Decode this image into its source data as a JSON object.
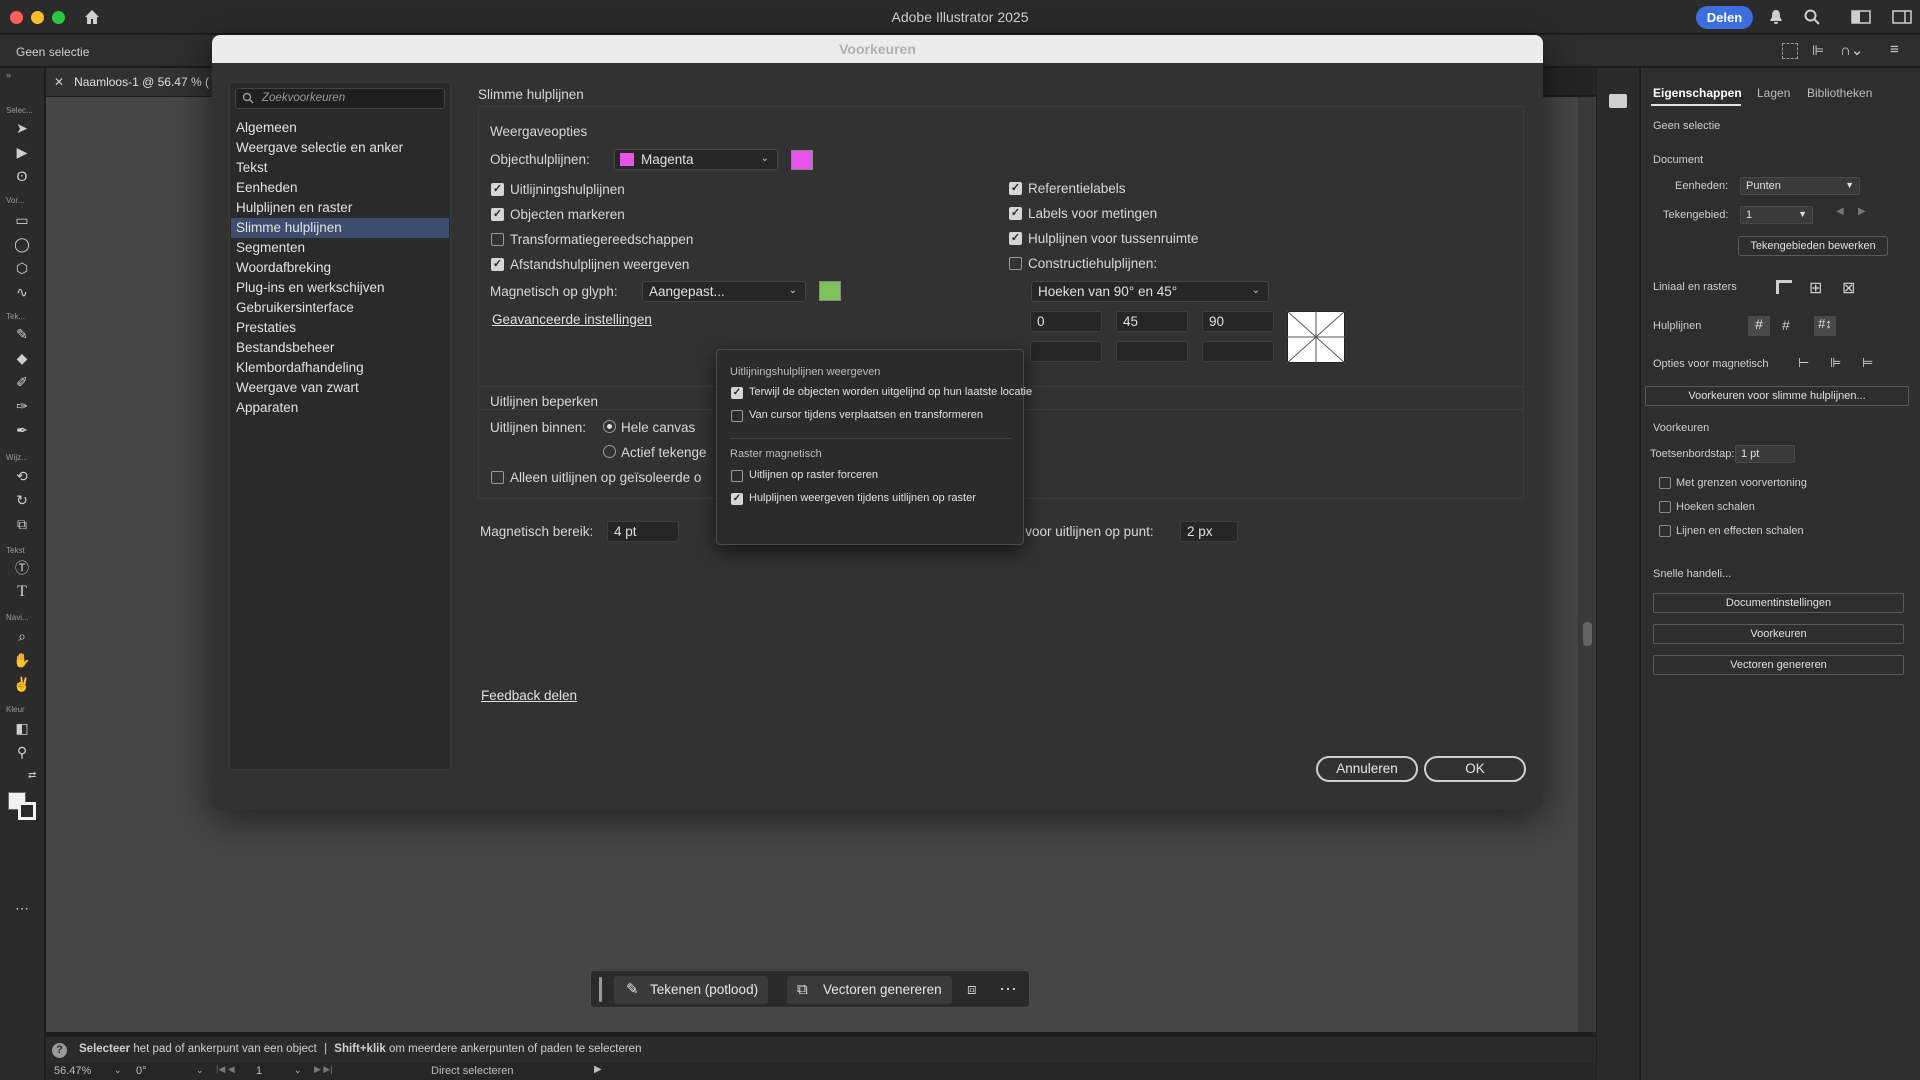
{
  "app": {
    "title": "Adobe Illustrator 2025",
    "share_label": "Delen",
    "selection_state": "Geen selectie",
    "doc_tab": "Naamloos-1 @ 56.47 % ("
  },
  "toolbar_labels": {
    "select": "Selec...",
    "draw": "Vor...",
    "text_tools": "Tek...",
    "modify": "Wijz...",
    "type": "Tekst",
    "navigate": "Navi...",
    "color": "Kleur"
  },
  "dialog": {
    "title": "Voorkeuren",
    "search_placeholder": "Zoekvoorkeuren",
    "categories": [
      "Algemeen",
      "Weergave selectie en anker",
      "Tekst",
      "Eenheden",
      "Hulplijnen en raster",
      "Slimme hulplijnen",
      "Segmenten",
      "Woordafbreking",
      "Plug-ins en werkschijven",
      "Gebruikersinterface",
      "Prestaties",
      "Bestandsbeheer",
      "Klembordafhandeling",
      "Weergave van zwart",
      "Apparaten"
    ],
    "active_category_index": 5,
    "page_title": "Slimme hulplijnen",
    "display_options": {
      "heading": "Weergaveopties",
      "object_guides_label": "Objecthulplijnen:",
      "object_guides_value": "Magenta",
      "object_guides_color": "#e754e7",
      "checks_left": [
        {
          "label": "Uitlijningshulplijnen",
          "checked": true
        },
        {
          "label": "Objecten markeren",
          "checked": true
        },
        {
          "label": "Transformatiegereedschappen",
          "checked": false
        },
        {
          "label": "Afstandshulplijnen weergeven",
          "checked": true
        }
      ],
      "checks_right": [
        {
          "label": "Referentielabels",
          "checked": true
        },
        {
          "label": "Labels voor metingen",
          "checked": true
        },
        {
          "label": "Hulplijnen voor tussenruimte",
          "checked": true
        },
        {
          "label": "Constructiehulplijnen:",
          "checked": false
        }
      ],
      "glyph_snap_label": "Magnetisch op glyph:",
      "glyph_snap_value": "Aangepast...",
      "glyph_snap_color": "#7cc35a",
      "advanced_link": "Geavanceerde instellingen",
      "construction_value": "Hoeken van 90° en 45°",
      "angles": [
        "0",
        "45",
        "90",
        "",
        "",
        ""
      ]
    },
    "align_constraint": {
      "heading": "Uitlijnen beperken",
      "within_label": "Uitlijnen binnen:",
      "option_canvas": "Hele canvas",
      "option_artboard": "Actief tekenge",
      "isolated_label": "Alleen uitlijnen op geïsoleerde o"
    },
    "snap_range_label": "Magnetisch bereik:",
    "snap_range_value": "4 pt",
    "point_tolerance_label": "Tolerantie voor uitlijnen op punt:",
    "point_tolerance_value": "2 px",
    "feedback_link": "Feedback delen",
    "cancel_label": "Annuleren",
    "ok_label": "OK"
  },
  "popover": {
    "heading1": "Uitlijningshulplijnen weergeven",
    "items1": [
      {
        "label": "Terwijl de objecten worden uitgelijnd op hun laatste locatie",
        "checked": true
      },
      {
        "label": "Van cursor tijdens verplaatsen en transformeren",
        "checked": false
      }
    ],
    "heading2": "Raster magnetisch",
    "items2": [
      {
        "label": "Uitlijnen op raster forceren",
        "checked": false
      },
      {
        "label": "Hulplijnen weergeven tijdens uitlijnen op raster",
        "checked": true
      }
    ]
  },
  "properties": {
    "tabs": [
      "Eigenschappen",
      "Lagen",
      "Bibliotheken"
    ],
    "no_selection": "Geen selectie",
    "document_heading": "Document",
    "units_label": "Eenheden:",
    "units_value": "Punten",
    "artboard_label": "Tekengebied:",
    "artboard_value": "1",
    "edit_artboards": "Tekengebieden bewerken",
    "rulers_grids": "Liniaal en rasters",
    "guides": "Hulplijnen",
    "snap_options": "Opties voor magnetisch",
    "smart_guide_prefs": "Voorkeuren voor slimme hulplijnen...",
    "preferences_heading": "Voorkeuren",
    "keyboard_increment_label": "Toetsenbordstap:",
    "keyboard_increment_value": "1 pt",
    "checks": [
      "Met grenzen voorvertoning",
      "Hoeken schalen",
      "Lijnen en effecten schalen"
    ],
    "quick_actions": "Snelle handeli...",
    "btn_document_setup": "Documentinstellingen",
    "btn_preferences": "Voorkeuren",
    "btn_vectorize": "Vectoren genereren"
  },
  "context_bar": {
    "draw_label": "Tekenen (potlood)",
    "vectorize_label": "Vectoren genereren"
  },
  "status": {
    "hint_bold1": "Selecteer",
    "hint_text1": "het pad of ankerpunt van een object",
    "separator": "|",
    "hint_bold2": "Shift+klik",
    "hint_text2": "om meerdere ankerpunten of paden te selecteren",
    "zoom": "56.47%",
    "rotation": "0°",
    "artboard_nav": "1",
    "tool_name": "Direct selecteren"
  }
}
